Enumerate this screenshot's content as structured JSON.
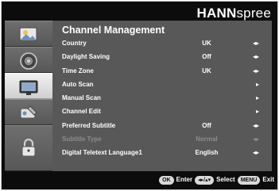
{
  "brand": {
    "bold": "HANN",
    "light": "spree"
  },
  "menu": {
    "title": "Channel Management",
    "rows": [
      {
        "label": "Country",
        "value": "UK",
        "arrow": "◂▸",
        "disabled": false
      },
      {
        "label": "Daylight Saving",
        "value": "Off",
        "arrow": "◂▸",
        "disabled": false
      },
      {
        "label": "Time Zone",
        "value": "UK",
        "arrow": "◂▸",
        "disabled": false
      },
      {
        "label": "Auto Scan",
        "value": "",
        "arrow": "▸",
        "disabled": false
      },
      {
        "label": "Manual Scan",
        "value": "",
        "arrow": "▸",
        "disabled": false
      },
      {
        "label": "Channel Edit",
        "value": "",
        "arrow": "▸",
        "disabled": false
      },
      {
        "label": "Preferred Subtitle",
        "value": "Off",
        "arrow": "◂▸",
        "disabled": false
      },
      {
        "label": "Subtitle Type",
        "value": "Normal",
        "arrow": "◂▸",
        "disabled": true
      },
      {
        "label": "Digital Teletext Language1",
        "value": "English",
        "arrow": "◂▸",
        "disabled": false
      }
    ]
  },
  "sidebar": {
    "tabs": [
      {
        "icon": "picture-icon",
        "active": false
      },
      {
        "icon": "speaker-icon",
        "active": false
      },
      {
        "icon": "tv-icon",
        "active": true
      },
      {
        "icon": "tools-icon",
        "active": false
      },
      {
        "icon": "lock-icon",
        "active": false
      }
    ]
  },
  "footer": {
    "ok_key": "OK",
    "enter_label": "Enter",
    "nav_key": "◂▸/▴▾",
    "select_label": "Select",
    "menu_key": "MENU",
    "exit_label": "Exit"
  }
}
